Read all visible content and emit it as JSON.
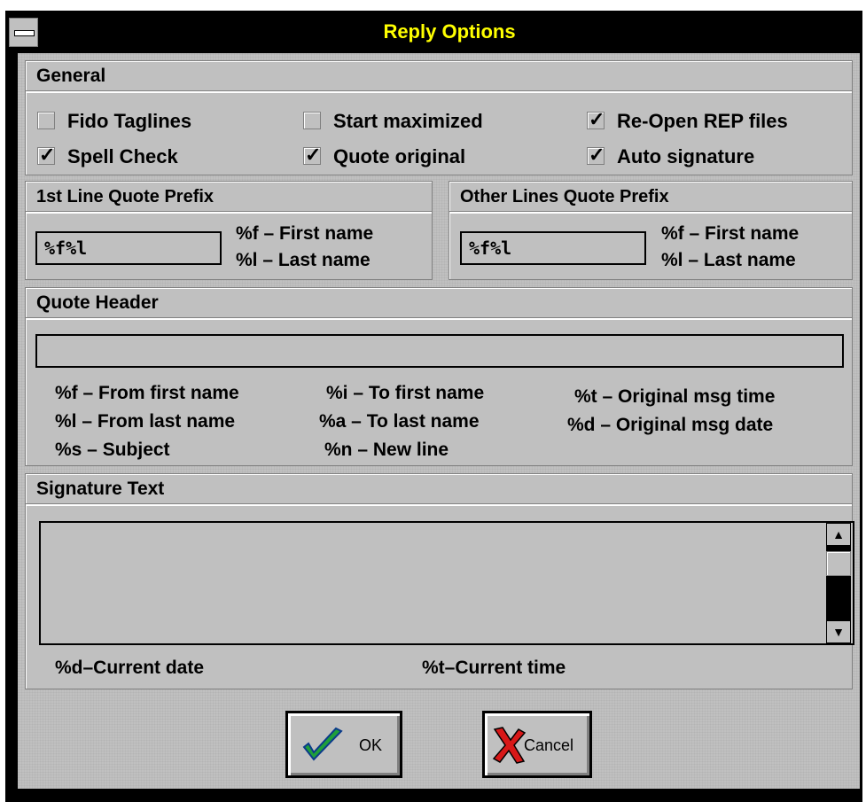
{
  "window": {
    "title": "Reply Options"
  },
  "general": {
    "title": "General",
    "options": [
      {
        "label": "Fido Taglines",
        "checked": false
      },
      {
        "label": "Start maximized",
        "checked": false
      },
      {
        "label": "Re-Open REP files",
        "checked": true
      },
      {
        "label": "Spell Check",
        "checked": true
      },
      {
        "label": "Quote original",
        "checked": true
      },
      {
        "label": "Auto signature",
        "checked": true
      }
    ],
    "check_glyph": "✓"
  },
  "first_prefix": {
    "title": "1st Line Quote Prefix",
    "value": "%f%l",
    "hint1": "%f – First name",
    "hint2": "%l – Last name"
  },
  "other_prefix": {
    "title": "Other Lines Quote Prefix",
    "value": "%f%l",
    "hint1": "%f – First name",
    "hint2": "%l – Last name"
  },
  "quote_header": {
    "title": "Quote Header",
    "value": "",
    "legend": [
      "%f – From first name",
      "%i – To first name",
      "%t – Original msg time",
      "%l – From last name",
      "%a – To last name",
      "%d – Original msg date",
      "%s – Subject",
      "%n – New line"
    ]
  },
  "signature": {
    "title": "Signature Text",
    "value": "",
    "legend": [
      "%d–Current date",
      "%t–Current time"
    ]
  },
  "buttons": {
    "ok": "OK",
    "cancel": "Cancel"
  },
  "icons": {
    "ok": "check-icon",
    "cancel": "x-icon",
    "system_menu": "system-menu-icon"
  },
  "colors": {
    "title_text": "#ffff00",
    "title_bar": "#000000",
    "face": "#c0c0c0",
    "ok_green": "#1f9f3a",
    "cancel_red": "#d81818"
  }
}
